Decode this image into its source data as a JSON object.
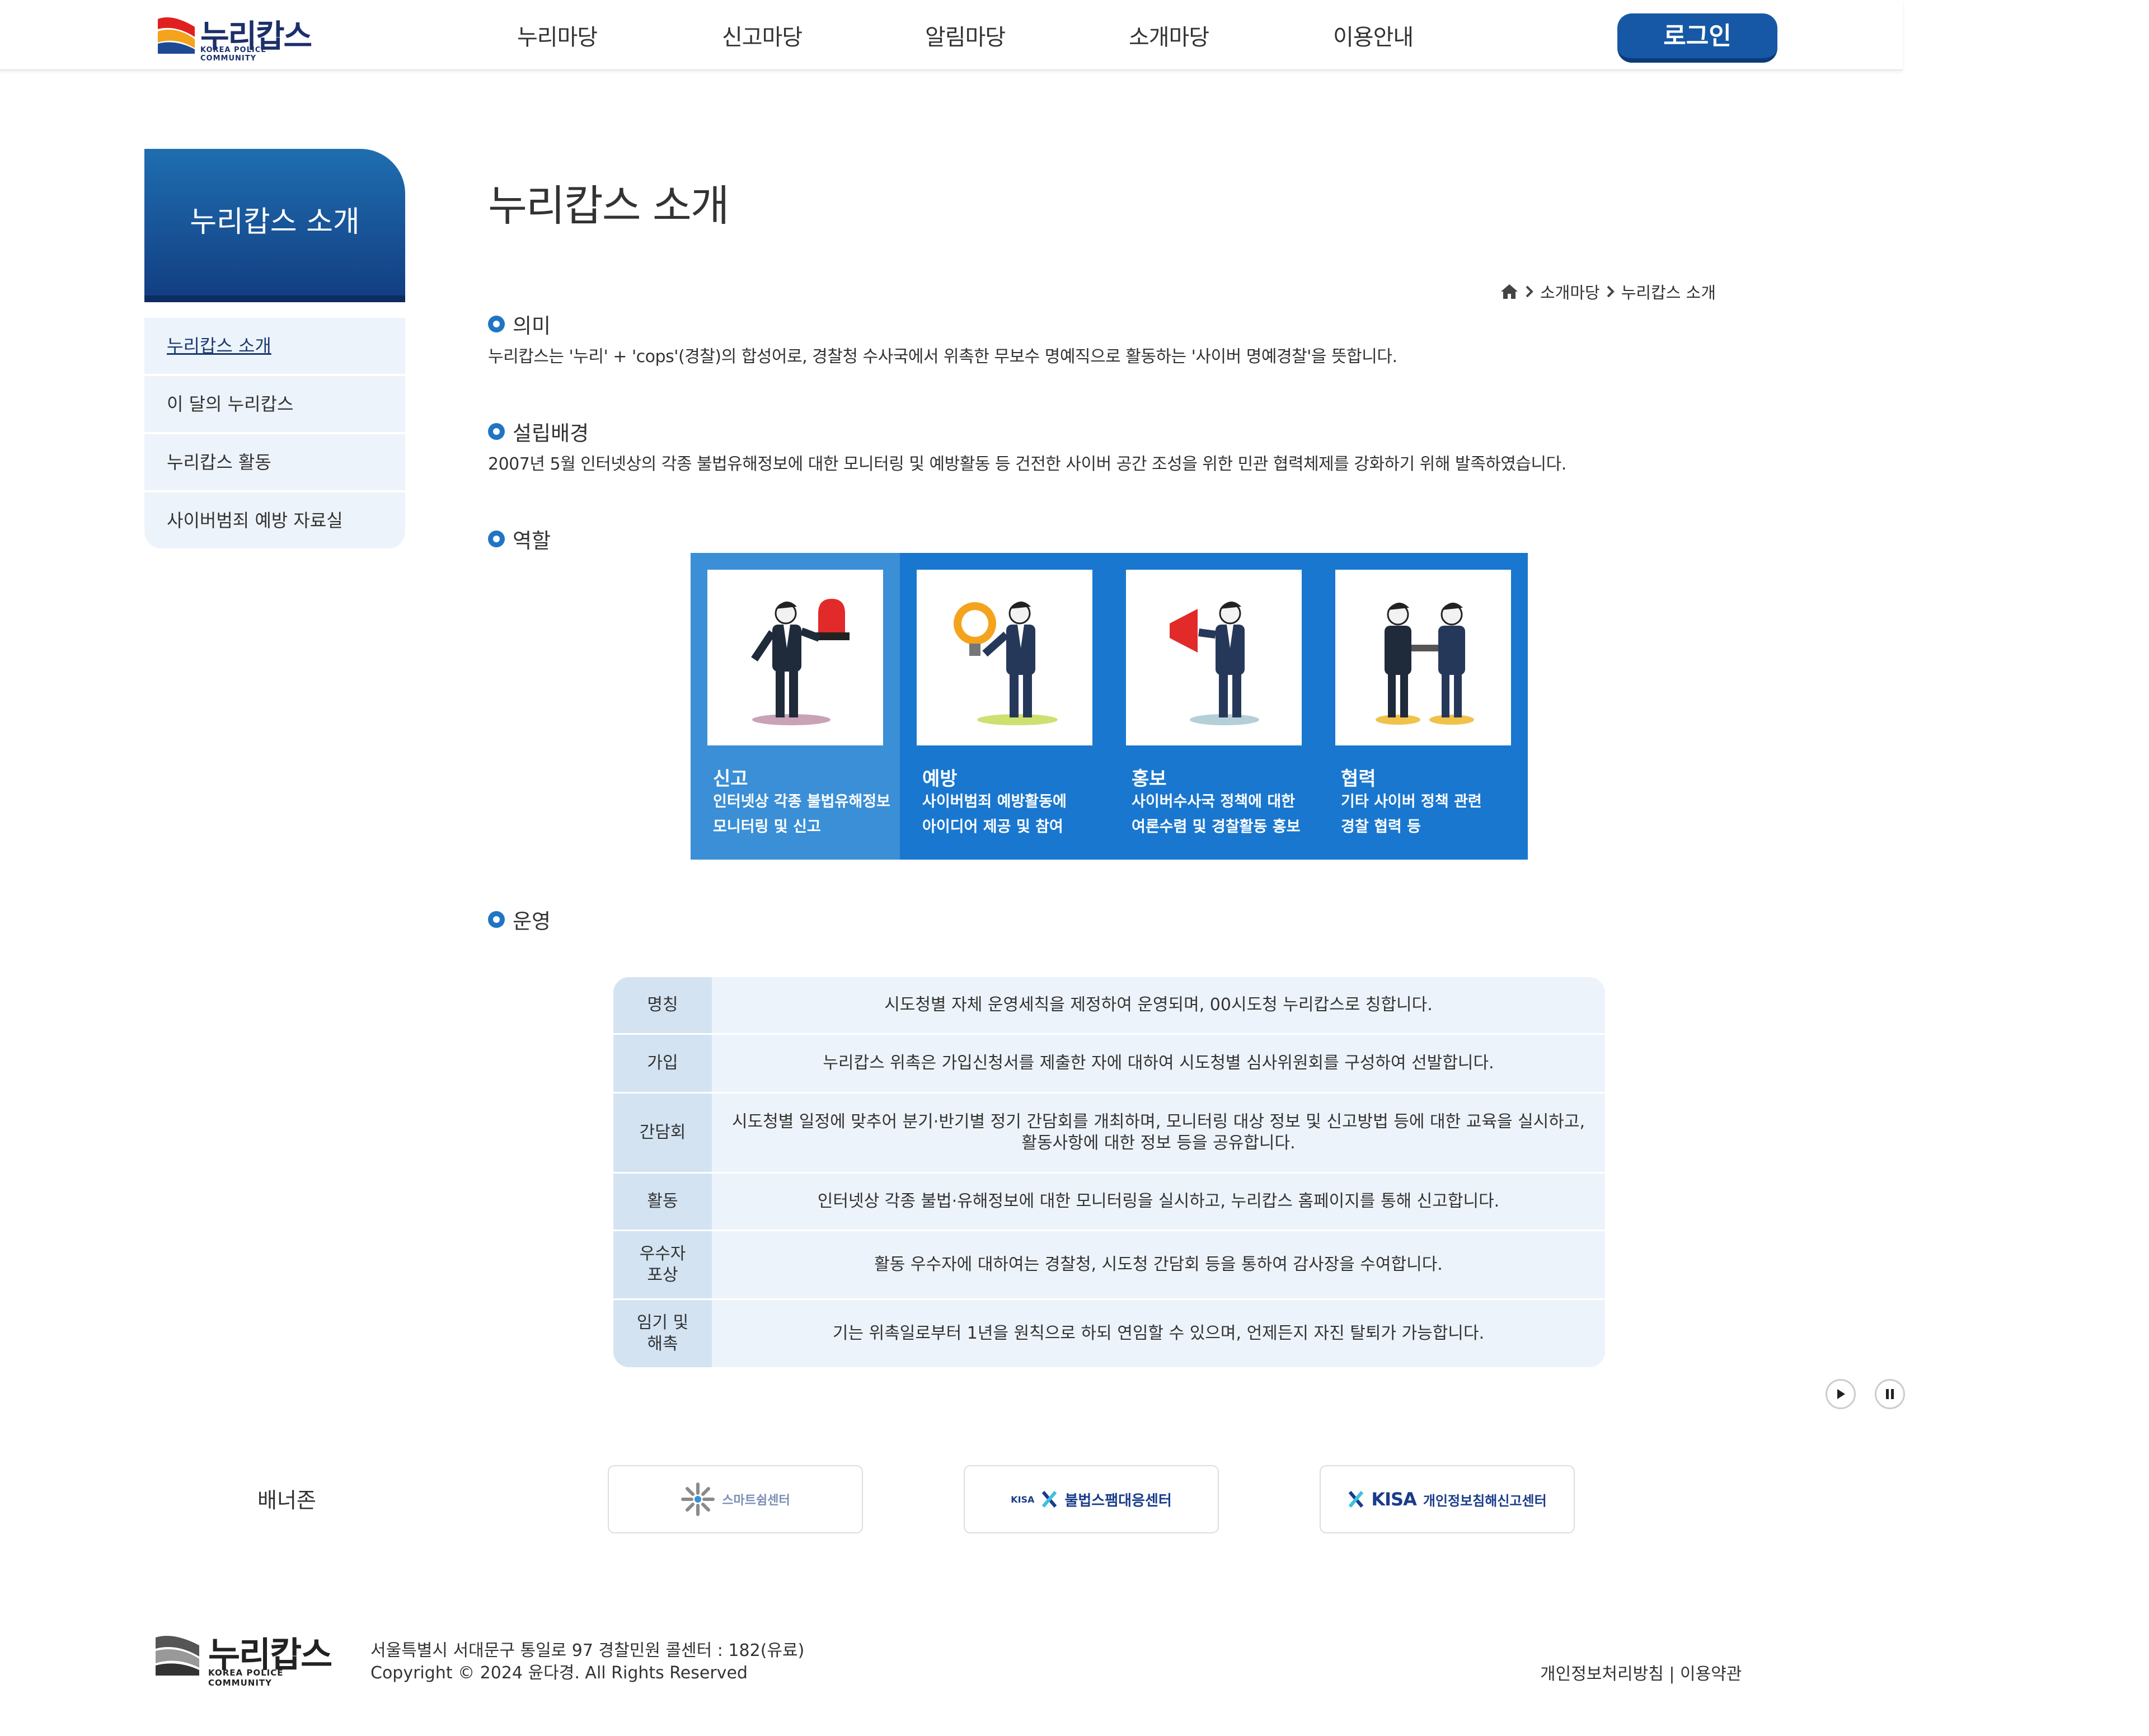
{
  "header": {
    "logo_text": "누리캅스",
    "logo_sub": "KOREA POLICE COMMUNITY",
    "nav": [
      "누리마당",
      "신고마당",
      "알림마당",
      "소개마당",
      "이용안내"
    ],
    "login": "로그인"
  },
  "sidebar": {
    "title": "누리캅스 소개",
    "items": [
      "누리캅스 소개",
      "이 달의 누리캅스",
      "누리캅스 활동",
      "사이버범죄 예방 자료실"
    ]
  },
  "main": {
    "title": "누리캅스 소개",
    "breadcrumb": [
      "소개마당",
      "누리캅스 소개"
    ],
    "sections": {
      "meaning": {
        "heading": "의미",
        "text": "누리캅스는 '누리' + 'cops'(경찰)의 합성어로, 경찰청 수사국에서 위촉한 무보수 명예직으로 활동하는 '사이버 명예경찰'을 뜻합니다."
      },
      "background": {
        "heading": "설립배경",
        "text": "2007년 5월 인터넷상의 각종 불법유해정보에 대한 모니터링 및 예방활동 등 건전한 사이버 공간 조성을 위한 민관 협력체제를 강화하기 위해 발족하였습니다."
      },
      "roles": {
        "heading": "역할",
        "items": [
          {
            "title": "신고",
            "desc": "인터넷상 각종 불법유해정보\n모니터링 및 신고",
            "bg": "#3a8fd6",
            "icon": "siren-icon"
          },
          {
            "title": "예방",
            "desc": "사이버범죄 예방활동에\n아이디어 제공 및 참여",
            "bg": "#1977cf",
            "icon": "lightbulb-icon"
          },
          {
            "title": "홍보",
            "desc": "사이버수사국 정책에 대한\n여론수렴 및 경찰활동 홍보",
            "bg": "#1977cf",
            "icon": "megaphone-icon"
          },
          {
            "title": "협력",
            "desc": "기타 사이버 정책 관련\n경찰 협력 등",
            "bg": "#1977cf",
            "icon": "handshake-icon"
          }
        ]
      },
      "operation": {
        "heading": "운영",
        "rows": [
          {
            "label": "명칭",
            "text": "시도청별 자체 운영세칙을 제정하여 운영되며, 00시도청 누리캅스로 칭합니다."
          },
          {
            "label": "가입",
            "text": "누리캅스 위촉은 가입신청서를 제출한 자에 대하여 시도청별 심사위원회를 구성하여 선발합니다."
          },
          {
            "label": "간담회",
            "text": "시도청별 일정에 맞추어 분기·반기별 정기 간담회를 개최하며, 모니터링 대상 정보 및 신고방법 등에 대한 교육을 실시하고,\n활동사항에 대한 정보 등을 공유합니다."
          },
          {
            "label": "활동",
            "text": "인터넷상 각종 불법·유해정보에 대한 모니터링을 실시하고, 누리캅스 홈페이지를 통해 신고합니다."
          },
          {
            "label": "우수자\n포상",
            "text": "활동 우수자에 대하여는 경찰청, 시도청 간담회 등을 통하여 감사장을 수여합니다."
          },
          {
            "label": "임기 및\n해촉",
            "text": "기는 위촉일로부터 1년을 원칙으로 하되 연임할 수 있으며, 언제든지 자진 탈퇴가 가능합니다."
          }
        ]
      }
    }
  },
  "banner": {
    "label": "배너존",
    "items": [
      {
        "text": "스마트쉼센터",
        "icon": "smart-shim-logo-icon",
        "color": "#7a8fb5"
      },
      {
        "text": "불법스팸대응센터",
        "icon": "kisa-logo-icon",
        "color": "#1a3c8a"
      },
      {
        "text": "개인정보침해신고센터",
        "icon": "kisa-logo-icon",
        "color": "#1a3c8a"
      }
    ],
    "banner_kisa": "KISA"
  },
  "footer": {
    "logo_text": "누리캅스",
    "logo_sub": "KOREA POLICE COMMUNITY",
    "address": "서울특별시 서대문구 통일로 97 경찰민원 콜센터 : 182(유료)",
    "copyright": "Copyright © 2024 윤다경. All Rights Reserved",
    "links": "개인정보처리방침 | 이용약관"
  },
  "colors": {
    "primary": "#1977cf",
    "primary_dark": "#133f83",
    "light_bg": "#edf3fa",
    "login_bg": "#1658a6"
  }
}
